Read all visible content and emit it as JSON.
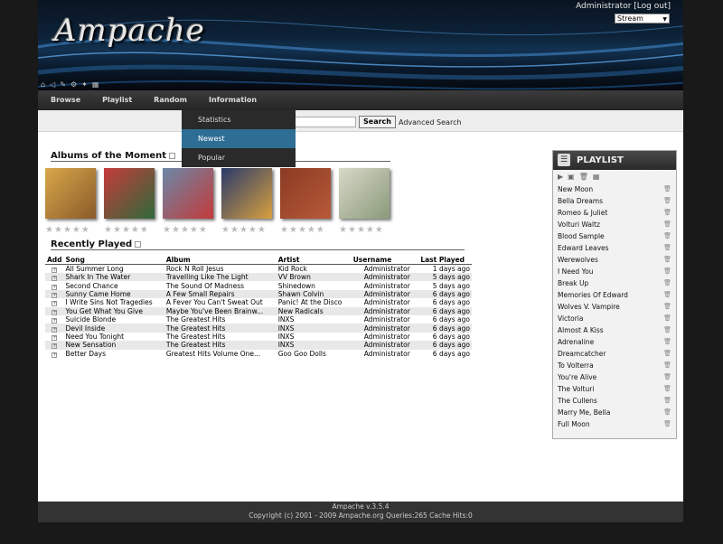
{
  "header": {
    "logo": "Ampache",
    "user": "Administrator",
    "logout": "[Log out]",
    "play_type": "Stream"
  },
  "iconbar": [
    "home-icon",
    "speaker-icon",
    "edit-icon",
    "gear-icon",
    "wrench-icon",
    "grid-icon"
  ],
  "nav": {
    "items": [
      "Browse",
      "Playlist",
      "Random",
      "Information"
    ]
  },
  "info_menu": {
    "items": [
      "Statistics",
      "Newest",
      "Popular"
    ],
    "active": "Newest"
  },
  "search": {
    "button": "Search",
    "advanced": "Advanced Search"
  },
  "albums": {
    "title": "Albums of the Moment",
    "covers": [
      {
        "colors": [
          "#d8a84a",
          "#8a5a2a"
        ]
      },
      {
        "colors": [
          "#c63a3a",
          "#2e6a3a"
        ]
      },
      {
        "colors": [
          "#6a88a8",
          "#c43a3a"
        ]
      },
      {
        "colors": [
          "#2a3a6a",
          "#d8a040"
        ]
      },
      {
        "colors": [
          "#8a3a22",
          "#b85a3a"
        ]
      },
      {
        "colors": [
          "#d8d8c8",
          "#8a9a7a"
        ]
      }
    ]
  },
  "recent": {
    "title": "Recently Played",
    "columns": [
      "Add",
      "Song",
      "Album",
      "Artist",
      "Username",
      "Last Played"
    ],
    "rows": [
      [
        "All Summer Long",
        "Rock N Roll Jesus",
        "Kid Rock",
        "Administrator",
        "1 days ago"
      ],
      [
        "Shark In The Water",
        "Travelling Like The Light",
        "VV Brown",
        "Administrator",
        "5 days ago"
      ],
      [
        "Second Chance",
        "The Sound Of Madness",
        "Shinedown",
        "Administrator",
        "5 days ago"
      ],
      [
        "Sunny Came Home",
        "A Few Small Repairs",
        "Shawn Colvin",
        "Administrator",
        "6 days ago"
      ],
      [
        "I Write Sins Not Tragedies",
        "A Fever You Can't Sweat Out",
        "Panic! At the Disco",
        "Administrator",
        "6 days ago"
      ],
      [
        "You Get What You Give",
        "Maybe You've Been Brainw...",
        "New Radicals",
        "Administrator",
        "6 days ago"
      ],
      [
        "Suicide Blonde",
        "The Greatest Hits",
        "INXS",
        "Administrator",
        "6 days ago"
      ],
      [
        "Devil Inside",
        "The Greatest Hits",
        "INXS",
        "Administrator",
        "6 days ago"
      ],
      [
        "Need You Tonight",
        "The Greatest Hits",
        "INXS",
        "Administrator",
        "6 days ago"
      ],
      [
        "New Sensation",
        "The Greatest Hits",
        "INXS",
        "Administrator",
        "6 days ago"
      ],
      [
        "Better Days",
        "Greatest Hits Volume One...",
        "Goo Goo Dolls",
        "Administrator",
        "6 days ago"
      ]
    ]
  },
  "playlist": {
    "title": "PLAYLIST",
    "items": [
      "New Moon",
      "Bella Dreams",
      "Romeo & Juliet",
      "Volturi Waltz",
      "Blood Sample",
      "Edward Leaves",
      "Werewolves",
      "I Need You",
      "Break Up",
      "Memories Of Edward",
      "Wolves V. Vampire",
      "Victoria",
      "Almost A Kiss",
      "Adrenaline",
      "Dreamcatcher",
      "To Volterra",
      "You're Alive",
      "The Volturi",
      "The Cullens",
      "Marry Me, Bella",
      "Full Moon"
    ]
  },
  "footer": {
    "version": "Ampache v.3.5.4",
    "copyright": "Copyright (c) 2001 - 2009 Ampache.org Queries:265 Cache Hits:0"
  }
}
